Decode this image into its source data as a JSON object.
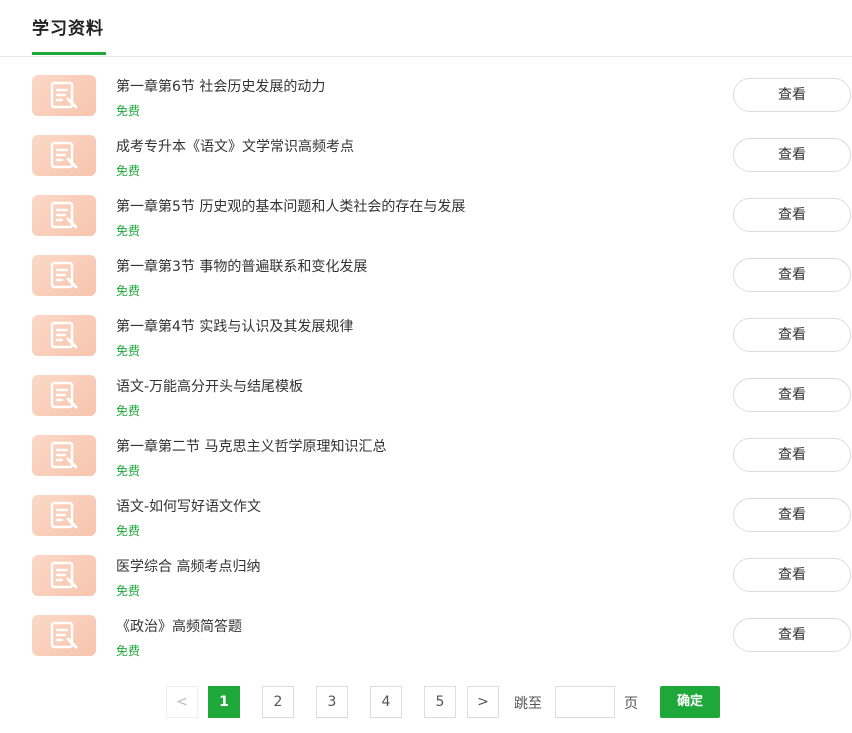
{
  "header": {
    "title": "学习资料"
  },
  "accent_color": "#1fa83a",
  "thumb_icon": "document-icon",
  "items": [
    {
      "title": "第一章第6节 社会历史发展的动力",
      "tag": "免费",
      "button": "查看"
    },
    {
      "title": "成考专升本《语文》文学常识高频考点",
      "tag": "免费",
      "button": "查看"
    },
    {
      "title": "第一章第5节 历史观的基本问题和人类社会的存在与发展",
      "tag": "免费",
      "button": "查看"
    },
    {
      "title": "第一章第3节 事物的普遍联系和变化发展",
      "tag": "免费",
      "button": "查看"
    },
    {
      "title": "第一章第4节 实践与认识及其发展规律",
      "tag": "免费",
      "button": "查看"
    },
    {
      "title": "语文-万能高分开头与结尾模板",
      "tag": "免费",
      "button": "查看"
    },
    {
      "title": "第一章第二节 马克思主义哲学原理知识汇总",
      "tag": "免费",
      "button": "查看"
    },
    {
      "title": "语文-如何写好语文作文",
      "tag": "免费",
      "button": "查看"
    },
    {
      "title": "医学综合 高频考点归纳",
      "tag": "免费",
      "button": "查看"
    },
    {
      "title": "《政治》高频简答题",
      "tag": "免费",
      "button": "查看"
    }
  ],
  "pagination": {
    "prev": "<",
    "pages": [
      "1",
      "2",
      "3",
      "4",
      "5"
    ],
    "current_page": "1",
    "next": ">",
    "jump_label": "跳至",
    "jump_value": "",
    "page_unit": "页",
    "confirm": "确定"
  }
}
